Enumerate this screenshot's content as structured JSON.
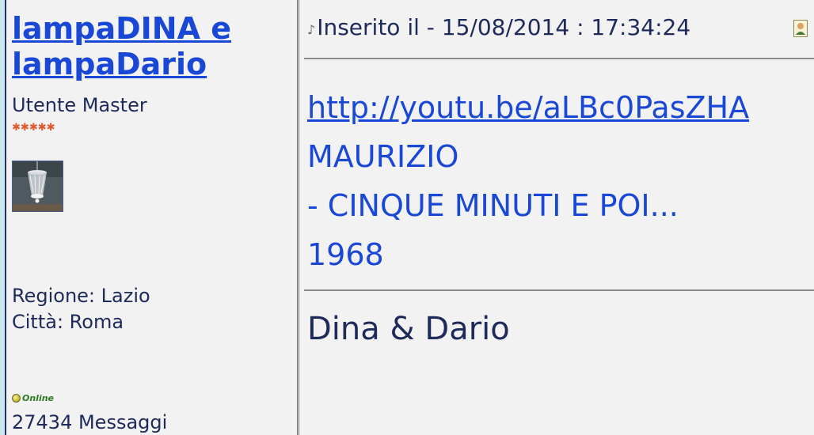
{
  "author": {
    "name": "lampaDINA e lampaDario",
    "rank": "Utente Master",
    "stars": 5,
    "region": "Regione: Lazio",
    "city": "Città: Roma",
    "online_status": "Online",
    "messages": "27434 Messaggi",
    "star_color": "#e3592b"
  },
  "post": {
    "posted_at": "Inserito il - 15/08/2014 : 17:34:24",
    "link": "http://youtu.be/aLBc0PasZHA",
    "lines": [
      "MAURIZIO",
      "- CINQUE MINUTI E POI...",
      "1968"
    ],
    "signature": "Dina & Dario"
  },
  "icons": {
    "meta": "music-note-icon",
    "profile": "profile-icon",
    "online": "online-status-icon",
    "avatar": "chandelier-avatar"
  },
  "colors": {
    "link": "#1a48d6",
    "text": "#1e2a5a",
    "background": "#f2f2f2",
    "page_bg": "#c9e7ee"
  }
}
